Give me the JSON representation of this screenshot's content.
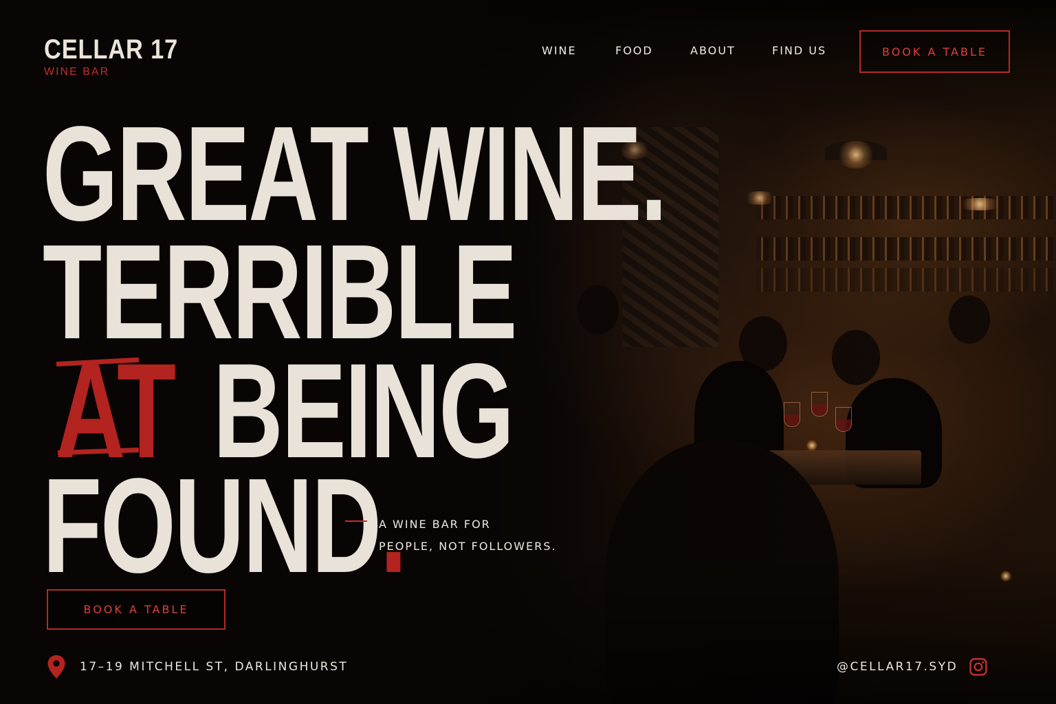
{
  "brand": {
    "name": "CELLAR 17",
    "subtitle": "WINE BAR"
  },
  "nav": {
    "items": [
      {
        "label": "WINE"
      },
      {
        "label": "FOOD"
      },
      {
        "label": "ABOUT"
      },
      {
        "label": "FIND US"
      }
    ],
    "cta_label": "BOOK A TABLE"
  },
  "hero": {
    "line1": "GREAT WINE.",
    "line2": "TERRIBLE",
    "line3_highlight": "AT",
    "line3_rest": "BEING",
    "line4_word": "FOUND",
    "line4_punct": ".",
    "tagline_1": "A WINE BAR FOR",
    "tagline_2": "PEOPLE, NOT FOLLOWERS.",
    "cta_label": "BOOK A TABLE"
  },
  "footer": {
    "address": "17–19 MITCHELL ST, DARLINGHURST",
    "social_handle": "@CELLAR17.SYD",
    "location_icon": "map-pin-icon",
    "social_icon": "instagram-icon"
  },
  "colors": {
    "background": "#0a0706",
    "text": "#efe8df",
    "accent_red": "#b3231f"
  }
}
